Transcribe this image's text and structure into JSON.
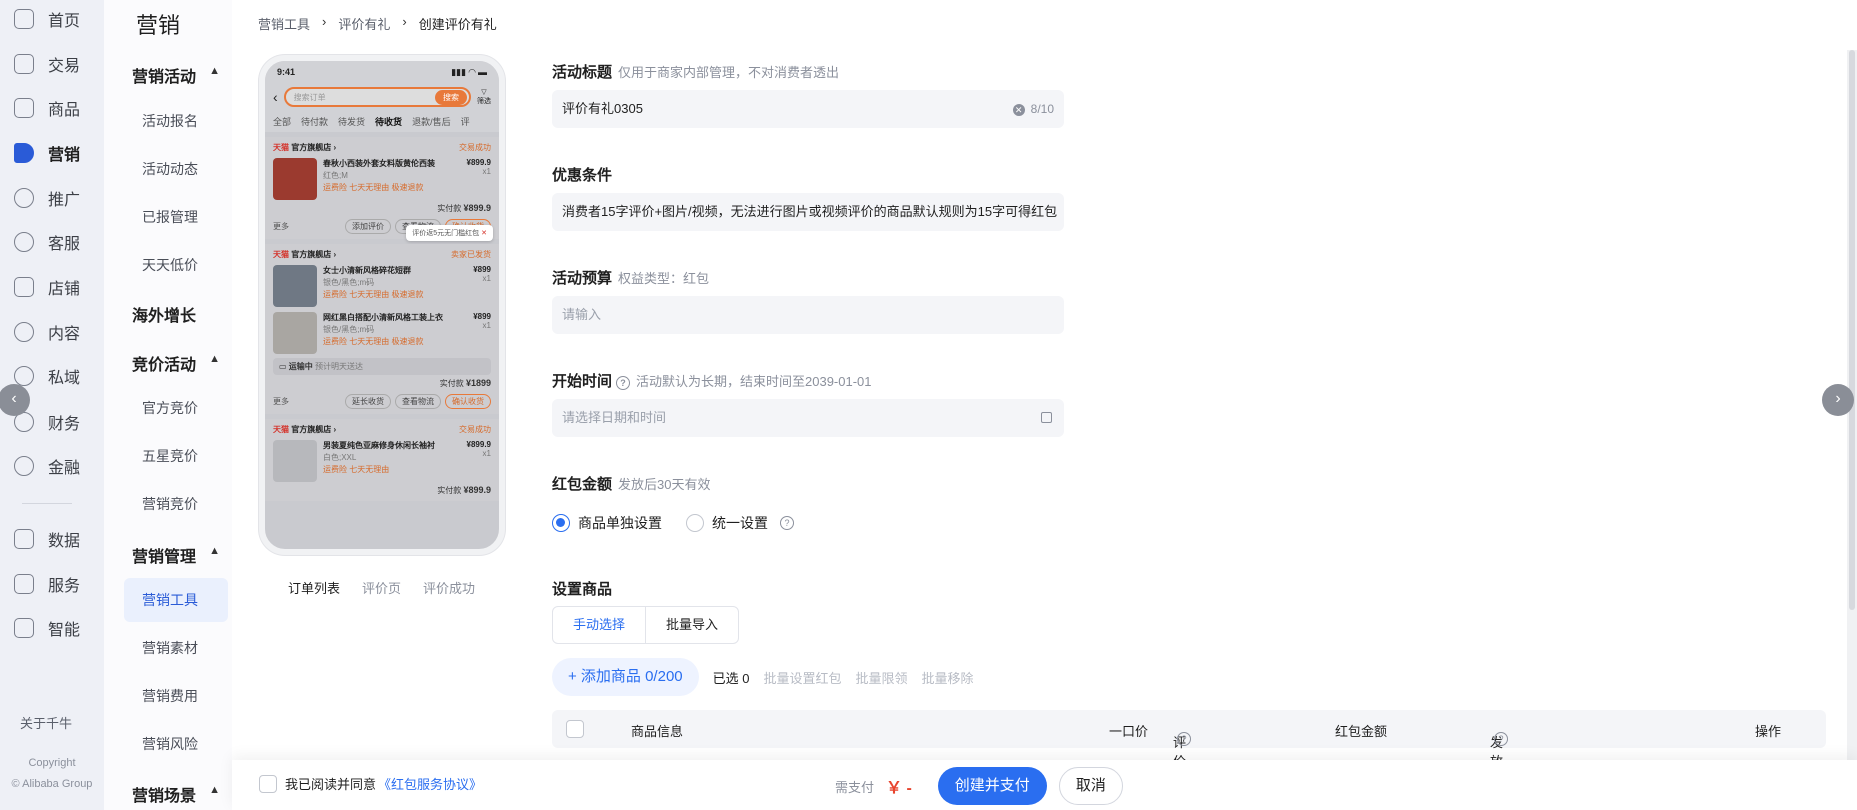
{
  "rail": {
    "items": [
      {
        "label": "首页",
        "icon": "home-icon"
      },
      {
        "label": "交易",
        "icon": "trade-icon"
      },
      {
        "label": "商品",
        "icon": "goods-icon"
      },
      {
        "label": "营销",
        "icon": "megaphone-icon"
      },
      {
        "label": "推广",
        "icon": "promote-icon"
      },
      {
        "label": "客服",
        "icon": "headset-icon"
      },
      {
        "label": "店铺",
        "icon": "store-icon"
      },
      {
        "label": "内容",
        "icon": "content-icon"
      },
      {
        "label": "私域",
        "icon": "private-icon"
      },
      {
        "label": "财务",
        "icon": "finance-icon"
      },
      {
        "label": "金融",
        "icon": "bank-icon"
      },
      {
        "label": "数据",
        "icon": "chart-icon"
      },
      {
        "label": "服务",
        "icon": "service-icon"
      },
      {
        "label": "智能",
        "icon": "lightning-icon"
      }
    ],
    "about": "关于千牛",
    "copyright_1": "Copyright",
    "copyright_2": "© Alibaba Group"
  },
  "menu": {
    "title": "营销",
    "groups": [
      {
        "label": "营销活动",
        "items": [
          "活动报名",
          "活动动态",
          "已报管理",
          "天天低价"
        ]
      },
      {
        "label": "海外增长",
        "items": []
      },
      {
        "label": "竞价活动",
        "items": [
          "官方竞价",
          "五星竞价",
          "营销竞价"
        ]
      },
      {
        "label": "营销管理",
        "items": [
          "营销工具",
          "营销素材",
          "营销费用",
          "营销风险"
        ]
      },
      {
        "label": "营销场景",
        "items": []
      }
    ]
  },
  "breadcrumb": [
    "营销工具",
    "评价有礼",
    "创建评价有礼"
  ],
  "phone": {
    "time": "9:41",
    "search_placeholder": "搜索订单",
    "search_btn": "搜索",
    "filter": "筛选",
    "tabs": [
      "全部",
      "待付款",
      "待发货",
      "待收货",
      "退款/售后",
      "评"
    ],
    "orders": [
      {
        "brand": "天猫",
        "shop": "官方旗舰店",
        "status": "交易成功",
        "items": [
          {
            "name": "春秋小西装外套女料版黄伦西装",
            "spec": "红色;M",
            "tags": "运费险  七天无理由  极速退款",
            "price": "¥899.9",
            "qty": "x1"
          }
        ],
        "total_label": "实付款",
        "total": "¥899.9",
        "more": "更多",
        "actions": [
          "添加评价",
          "查看物流",
          "确认收货"
        ],
        "tip": "评价返5元无门槛红包"
      },
      {
        "brand": "天猫",
        "shop": "官方旗舰店",
        "status": "卖家已发货",
        "items": [
          {
            "name": "女士小清新风格碎花短群",
            "spec": "银色/黑色;m码",
            "tags": "运费险  七天无理由  极速退款",
            "price": "¥899",
            "qty": "x1"
          },
          {
            "name": "网红黑白搭配小清新风格工装上衣",
            "spec": "银色/黑色;m码",
            "tags": "运费险  七天无理由  极速退款",
            "price": "¥899",
            "qty": "x1"
          }
        ],
        "shipping": "运输中",
        "shipping_eta": "预计明天送达",
        "total_label": "实付款",
        "total": "¥1899",
        "more": "更多",
        "actions": [
          "延长收货",
          "查看物流",
          "确认收货"
        ]
      },
      {
        "brand": "天猫",
        "shop": "官方旗舰店",
        "status": "交易成功",
        "items": [
          {
            "name": "男装夏纯色亚麻修身休闲长袖衬",
            "spec": "白色;XXL",
            "tags": "运费险  七天无理由",
            "price": "¥899.9",
            "qty": "x1"
          }
        ],
        "total_label": "实付款",
        "total": "¥899.9"
      }
    ],
    "preview_tabs": [
      "订单列表",
      "评价页",
      "评价成功"
    ]
  },
  "form": {
    "title_label": "活动标题",
    "title_hint": "仅用于商家内部管理，不对消费者透出",
    "title_value": "评价有礼0305",
    "title_count": "8/10",
    "cond_label": "优惠条件",
    "cond_value": "消费者15字评价+图片/视频，无法进行图片或视频评价的商品默认规则为15字可得红包",
    "budget_label": "活动预算",
    "budget_hint": "权益类型：红包",
    "budget_placeholder": "请输入",
    "start_label": "开始时间",
    "start_hint": "活动默认为长期，结束时间至2039-01-01",
    "start_placeholder": "请选择日期和时间",
    "amount_label": "红包金额",
    "amount_hint": "发放后30天有效",
    "radio_1": "商品单独设置",
    "radio_2": "统一设置",
    "goods_label": "设置商品",
    "seg_1": "手动选择",
    "seg_2": "批量导入",
    "add_btn": "+ 添加商品 0/200",
    "selected": "已选 0",
    "batch_1": "批量设置红包",
    "batch_2": "批量限领",
    "batch_3": "批量移除",
    "table_headers": [
      "商品信息",
      "一口价",
      "评价数量",
      "红包金额",
      "发放数量上限",
      "操作"
    ]
  },
  "footer": {
    "agree_prefix": "我已阅读并同意",
    "agree_link": "《红包服务协议》",
    "need_pay": "需支付",
    "amount": "￥ -",
    "submit": "创建并支付",
    "cancel": "取消"
  },
  "colors": {
    "accent": "#2a6ef0",
    "price": "#e8442e",
    "orange": "#e8793a"
  }
}
